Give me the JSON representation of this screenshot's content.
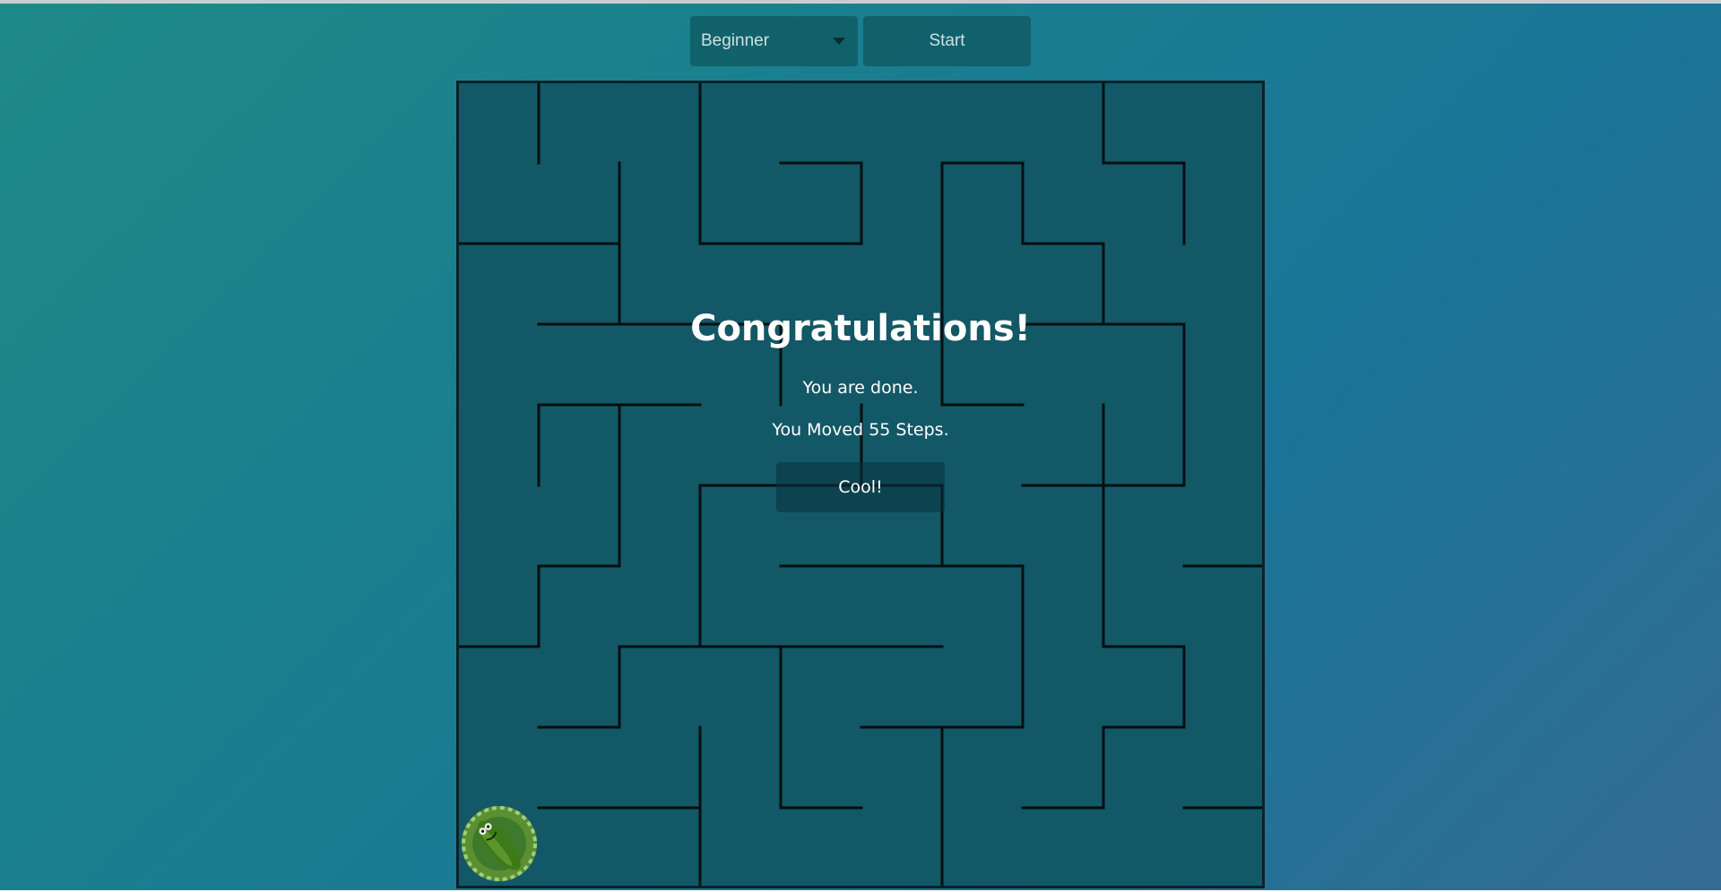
{
  "controls": {
    "difficulty_selected": "Beginner",
    "start_label": "Start"
  },
  "maze": {
    "rows": 10,
    "cols": 10,
    "horizontal_walls": [
      [
        0,
        3,
        1,
        1,
        0,
        0,
        0,
        0,
        0,
        0
      ],
      [
        0,
        0,
        1,
        1,
        1,
        0,
        1,
        1,
        1,
        0
      ],
      [
        1,
        1,
        0,
        1,
        0,
        0,
        1,
        1,
        1,
        0
      ],
      [
        0,
        1,
        1,
        1,
        0,
        0,
        1,
        1,
        1,
        0
      ],
      [
        0,
        1,
        1,
        0,
        1,
        0,
        1,
        1,
        0,
        0
      ],
      [
        0,
        0,
        0,
        0,
        0,
        0,
        0,
        0,
        0,
        0
      ],
      [
        0,
        0,
        0,
        0,
        0,
        0,
        0,
        0,
        0,
        0
      ],
      [
        0,
        0,
        0,
        0,
        0,
        0,
        0,
        0,
        0,
        0
      ],
      [
        0,
        0,
        0,
        0,
        0,
        0,
        0,
        0,
        0,
        0
      ],
      [
        0,
        0,
        0,
        0,
        0,
        0,
        0,
        0,
        0,
        0
      ]
    ],
    "wall_color": "#050e10",
    "floor_color": "#135866",
    "border_color": "#0a2228"
  },
  "player": {
    "icon": "pickle-rick-icon",
    "row": 9,
    "col": 0
  },
  "dialog": {
    "title": "Congratulations!",
    "line1": "You are done.",
    "line2": "You Moved 55 Steps.",
    "button_label": "Cool!"
  },
  "colors": {
    "bg_start": "#1e8a88",
    "bg_end": "#346b92",
    "panel": "#0e565e"
  }
}
